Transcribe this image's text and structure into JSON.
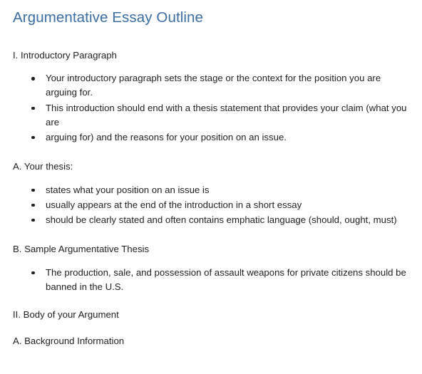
{
  "document": {
    "title": "Argumentative Essay Outline",
    "title_color": "#3a6ea5",
    "body_color": "#1f1f1f",
    "background_color": "#ffffff",
    "bullet_glyph": "•",
    "sections": [
      {
        "heading": "I. Introductory Paragraph",
        "bullets": [
          "Your introductory paragraph sets the stage or the context for the position you are arguing for.",
          "This introduction should end with a thesis statement that provides your claim (what you are",
          "arguing for) and the reasons for your position on an issue."
        ]
      },
      {
        "heading": "A. Your thesis:",
        "bullets": [
          "states what your position on an issue is",
          "usually appears at the end of the introduction in a short essay",
          "should be clearly stated and often contains emphatic language (should, ought, must)"
        ]
      },
      {
        "heading": "B. Sample Argumentative Thesis",
        "bullets": [
          "The production, sale, and possession of assault weapons for private citizens should be"
        ],
        "continuation": "banned in the U.S."
      },
      {
        "heading": "II. Body of your Argument",
        "bullets": []
      },
      {
        "heading": "A. Background Information",
        "bullets": []
      }
    ]
  }
}
